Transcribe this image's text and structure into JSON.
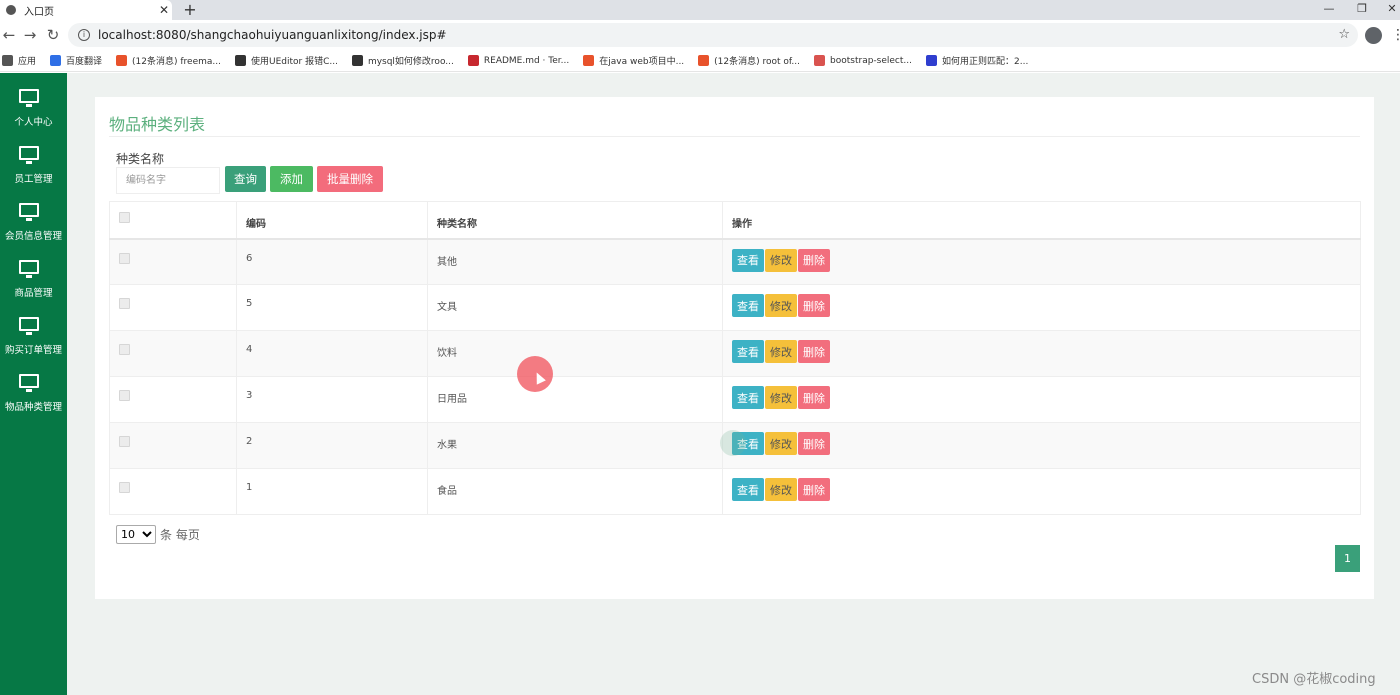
{
  "browser": {
    "tab_title": "入口页",
    "tab_close": "✕",
    "new_tab": "+",
    "url": "localhost:8080/shangchaohuiyuanguanlixitong/index.jsp#",
    "window_controls": [
      "—",
      "❐",
      "✕"
    ],
    "bookmarks": [
      {
        "label": "应用",
        "icon": "apps-icon",
        "color": "#555555"
      },
      {
        "label": "百度翻译",
        "icon": "translate-icon",
        "color": "#2f6fe6"
      },
      {
        "label": "(12条消息) freema...",
        "icon": "csdn-icon",
        "color": "#e8522b"
      },
      {
        "label": "使用UEditor 报错C...",
        "icon": "editor-icon",
        "color": "#333333"
      },
      {
        "label": "mysql如何修改roo...",
        "icon": "editor-icon",
        "color": "#333333"
      },
      {
        "label": "README.md · Ter...",
        "icon": "gitee-icon",
        "color": "#c7282f"
      },
      {
        "label": "在java web项目中...",
        "icon": "csdn-icon",
        "color": "#e8522b"
      },
      {
        "label": "(12条消息) root of...",
        "icon": "csdn-icon",
        "color": "#e8522b"
      },
      {
        "label": "bootstrap-select...",
        "icon": "cnblogs-icon",
        "color": "#d9534f"
      },
      {
        "label": "如何用正则匹配：2...",
        "icon": "baidu-icon",
        "color": "#2f3ecf"
      }
    ]
  },
  "sidebar": {
    "bg": "#067845",
    "items": [
      {
        "label": "个人中心",
        "icon": "monitor-icon"
      },
      {
        "label": "员工管理",
        "icon": "monitor-icon"
      },
      {
        "label": "会员信息管理",
        "icon": "monitor-icon"
      },
      {
        "label": "商品管理",
        "icon": "monitor-icon"
      },
      {
        "label": "购买订单管理",
        "icon": "monitor-icon"
      },
      {
        "label": "物品种类管理",
        "icon": "monitor-icon"
      }
    ]
  },
  "page": {
    "title": "物品种类列表",
    "filter_label": "种类名称",
    "search_placeholder": "编码名字",
    "buttons": {
      "query": "查询",
      "add": "添加",
      "batch_delete": "批量删除"
    }
  },
  "table": {
    "headers": [
      "",
      "编码",
      "种类名称",
      "操作"
    ],
    "rows": [
      {
        "code": "6",
        "name": "其他"
      },
      {
        "code": "5",
        "name": "文具"
      },
      {
        "code": "4",
        "name": "饮料"
      },
      {
        "code": "3",
        "name": "日用品"
      },
      {
        "code": "2",
        "name": "水果"
      },
      {
        "code": "1",
        "name": "食品"
      }
    ],
    "row_actions": {
      "view": "查看",
      "edit": "修改",
      "delete": "删除"
    }
  },
  "pagination": {
    "page_size": "10",
    "page_size_options": [
      "10"
    ],
    "per_page_label": "条 每页",
    "current_page": "1"
  },
  "colors": {
    "accent": "#3aa07a",
    "title": "#5cb07e",
    "view": "#3db2c5",
    "edit": "#f5c03a",
    "delete": "#f26e7d"
  },
  "watermark": "CSDN @花椒coding"
}
